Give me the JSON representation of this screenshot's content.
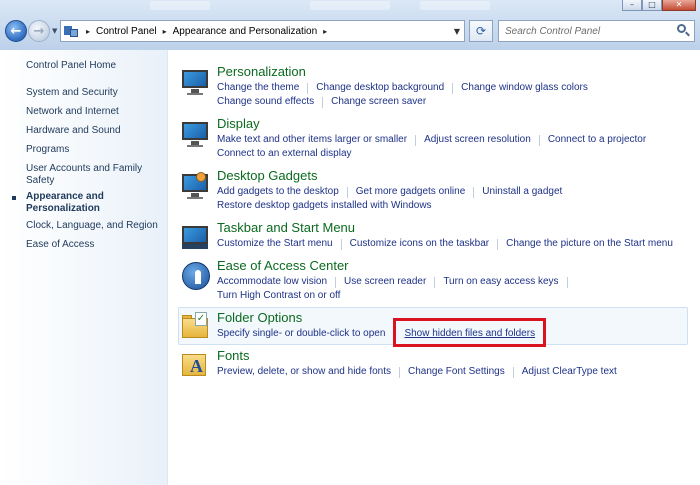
{
  "address_bar": {
    "crumbs": [
      "Control Panel",
      "Appearance and Personalization"
    ]
  },
  "search": {
    "placeholder": "Search Control Panel"
  },
  "sidebar": {
    "items": [
      {
        "label": "Control Panel Home"
      },
      {
        "label": "System and Security"
      },
      {
        "label": "Network and Internet"
      },
      {
        "label": "Hardware and Sound"
      },
      {
        "label": "Programs"
      },
      {
        "label": "User Accounts and Family Safety"
      },
      {
        "label": "Appearance and Personalization",
        "active": true
      },
      {
        "label": "Clock, Language, and Region"
      },
      {
        "label": "Ease of Access"
      }
    ]
  },
  "categories": [
    {
      "title": "Personalization",
      "icon": "personalization-icon",
      "rows": [
        [
          "Change the theme",
          "Change desktop background",
          "Change window glass colors"
        ],
        [
          "Change sound effects",
          "Change screen saver"
        ]
      ]
    },
    {
      "title": "Display",
      "icon": "display-icon",
      "rows": [
        [
          "Make text and other items larger or smaller",
          "Adjust screen resolution",
          "Connect to a projector"
        ],
        [
          "Connect to an external display"
        ]
      ]
    },
    {
      "title": "Desktop Gadgets",
      "icon": "desktop-gadgets-icon",
      "rows": [
        [
          "Add gadgets to the desktop",
          "Get more gadgets online",
          "Uninstall a gadget"
        ],
        [
          "Restore desktop gadgets installed with Windows"
        ]
      ]
    },
    {
      "title": "Taskbar and Start Menu",
      "icon": "taskbar-icon",
      "rows": [
        [
          "Customize the Start menu",
          "Customize icons on the taskbar",
          "Change the picture on the Start menu"
        ]
      ]
    },
    {
      "title": "Ease of Access Center",
      "icon": "ease-of-access-icon",
      "rows": [
        [
          "Accommodate low vision",
          "Use screen reader",
          "Turn on easy access keys"
        ],
        [
          "Turn High Contrast on or off"
        ]
      ]
    },
    {
      "title": "Folder Options",
      "icon": "folder-options-icon",
      "rows": [
        [
          "Specify single- or double-click to open",
          "Show hidden files and folders"
        ]
      ]
    },
    {
      "title": "Fonts",
      "icon": "fonts-icon",
      "rows": [
        [
          "Preview, delete, or show and hide fonts",
          "Change Font Settings",
          "Adjust ClearType text"
        ]
      ]
    }
  ],
  "highlight_color": "#d9131f",
  "title_color": "#0b6a1f",
  "link_color": "#1e3287"
}
